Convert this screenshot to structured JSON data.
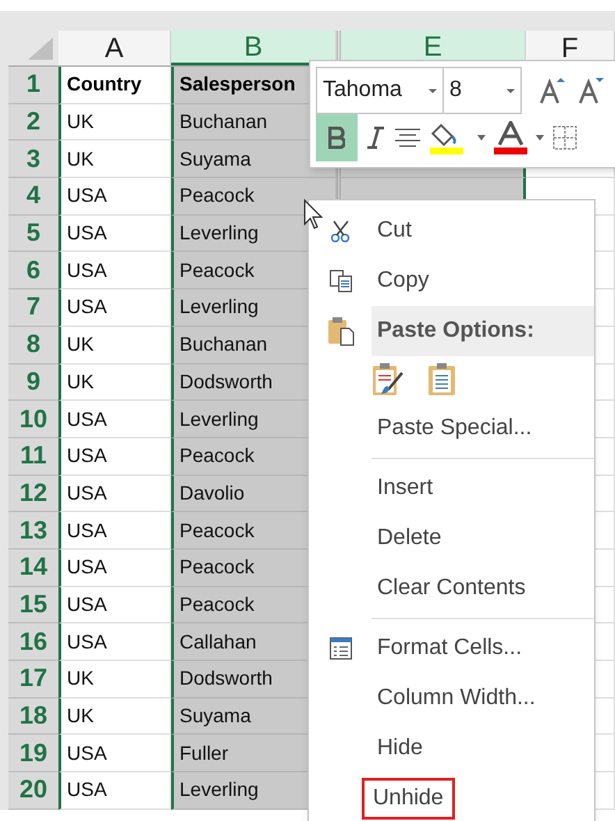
{
  "columns": [
    {
      "label": "A",
      "selected": false
    },
    {
      "label": "B",
      "selected": true
    },
    {
      "label": "E",
      "selected": true
    },
    {
      "label": "F",
      "selected": false
    }
  ],
  "rows": [
    {
      "number": "1",
      "kind": "header",
      "country": "Country",
      "salesperson": "Salesperson"
    },
    {
      "number": "2",
      "kind": "data",
      "country": "UK",
      "salesperson": "Buchanan"
    },
    {
      "number": "3",
      "kind": "data",
      "country": "UK",
      "salesperson": "Suyama"
    },
    {
      "number": "4",
      "kind": "data",
      "country": "USA",
      "salesperson": "Peacock"
    },
    {
      "number": "5",
      "kind": "data",
      "country": "USA",
      "salesperson": "Leverling"
    },
    {
      "number": "6",
      "kind": "data",
      "country": "USA",
      "salesperson": "Peacock"
    },
    {
      "number": "7",
      "kind": "data",
      "country": "USA",
      "salesperson": "Leverling"
    },
    {
      "number": "8",
      "kind": "data",
      "country": "UK",
      "salesperson": "Buchanan"
    },
    {
      "number": "9",
      "kind": "data",
      "country": "UK",
      "salesperson": "Dodsworth"
    },
    {
      "number": "10",
      "kind": "data",
      "country": "USA",
      "salesperson": "Leverling"
    },
    {
      "number": "11",
      "kind": "data",
      "country": "USA",
      "salesperson": "Peacock"
    },
    {
      "number": "12",
      "kind": "data",
      "country": "USA",
      "salesperson": "Davolio"
    },
    {
      "number": "13",
      "kind": "data",
      "country": "USA",
      "salesperson": "Peacock"
    },
    {
      "number": "14",
      "kind": "data",
      "country": "USA",
      "salesperson": "Peacock"
    },
    {
      "number": "15",
      "kind": "data",
      "country": "USA",
      "salesperson": "Peacock"
    },
    {
      "number": "16",
      "kind": "data",
      "country": "USA",
      "salesperson": "Callahan"
    },
    {
      "number": "17",
      "kind": "data",
      "country": "UK",
      "salesperson": "Dodsworth"
    },
    {
      "number": "18",
      "kind": "data",
      "country": "UK",
      "salesperson": "Suyama"
    },
    {
      "number": "19",
      "kind": "data",
      "country": "USA",
      "salesperson": "Fuller"
    },
    {
      "number": "20",
      "kind": "data",
      "country": "USA",
      "salesperson": "Leverling"
    }
  ],
  "mini_toolbar": {
    "font": "Tahoma",
    "size": "8",
    "bold": {
      "selected": true
    }
  },
  "context_menu": {
    "items": [
      {
        "kind": "cut",
        "label": "Cut",
        "outlined": false
      },
      {
        "kind": "copy",
        "label": "Copy",
        "outlined": false
      },
      {
        "kind": "paste-header",
        "label": "Paste Options:",
        "outlined": false
      },
      {
        "kind": "paste-icons"
      },
      {
        "kind": "plain",
        "label": "Paste Special...",
        "outlined": false
      },
      {
        "kind": "separator"
      },
      {
        "kind": "plain",
        "label": "Insert",
        "outlined": false
      },
      {
        "kind": "plain",
        "label": "Delete",
        "outlined": false
      },
      {
        "kind": "plain",
        "label": "Clear Contents",
        "outlined": false
      },
      {
        "kind": "separator"
      },
      {
        "kind": "format",
        "label": "Format Cells...",
        "outlined": false
      },
      {
        "kind": "plain",
        "label": "Column Width...",
        "outlined": false
      },
      {
        "kind": "plain",
        "label": "Hide",
        "outlined": false
      },
      {
        "kind": "plain",
        "label": "Unhide",
        "outlined": true
      }
    ]
  }
}
